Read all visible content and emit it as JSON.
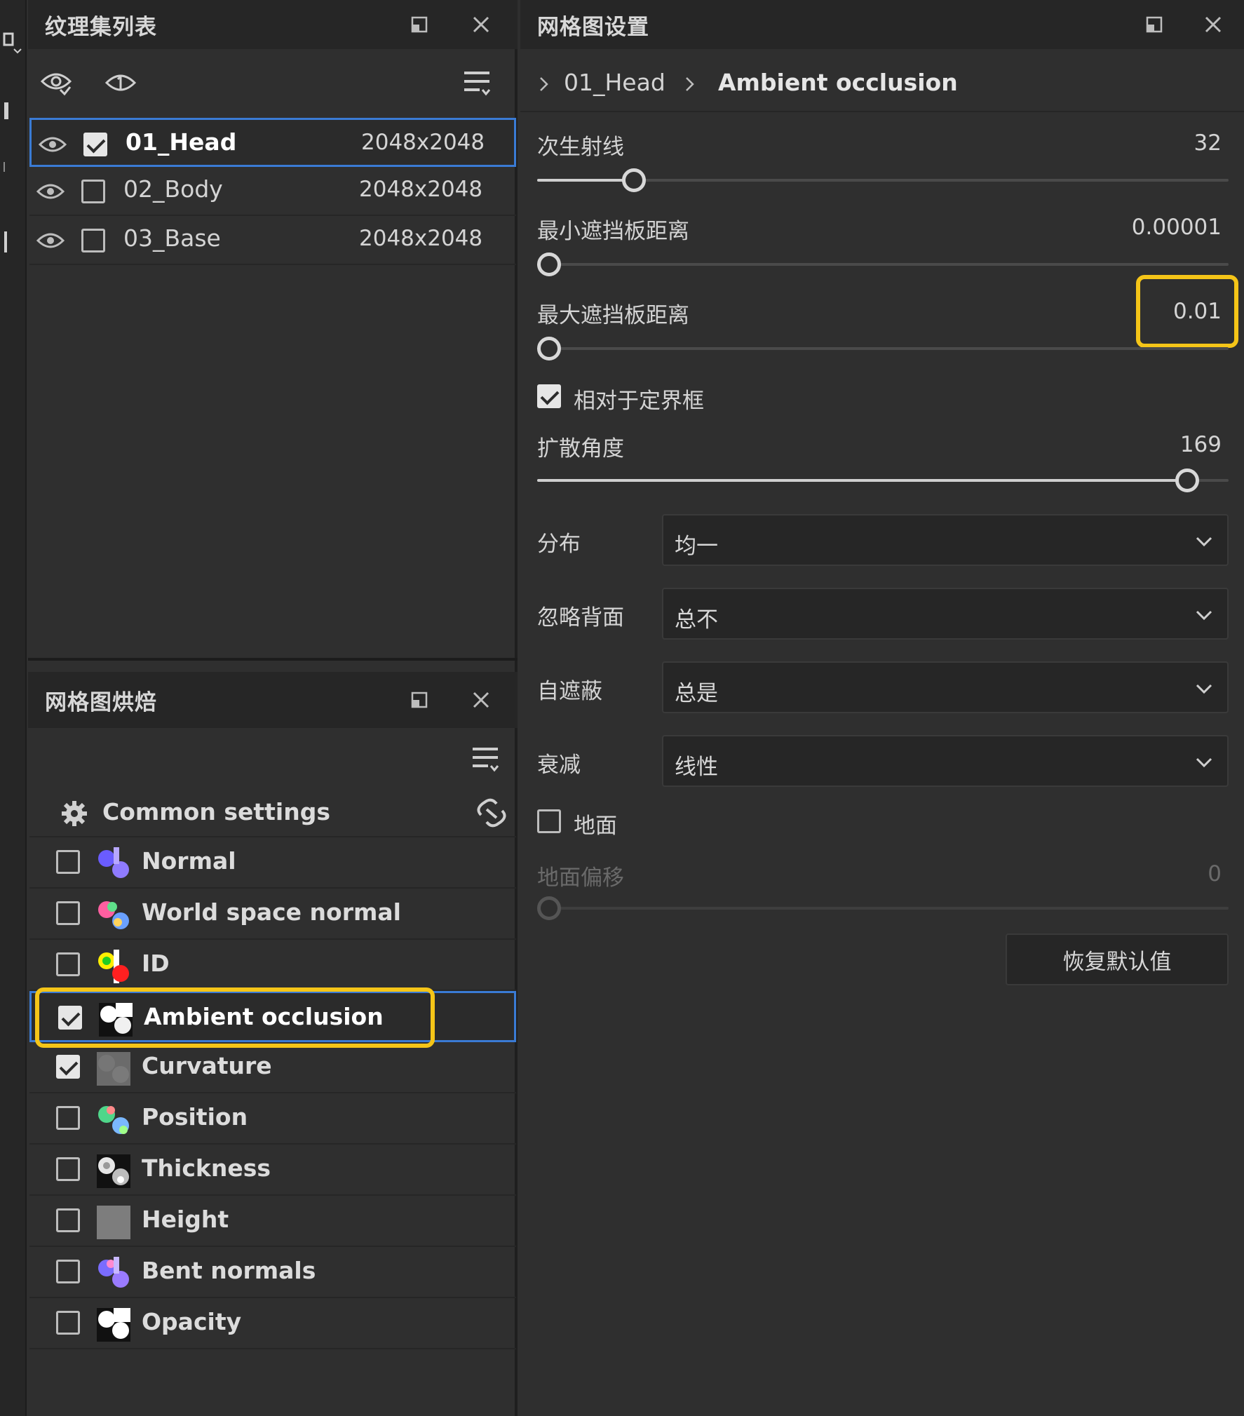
{
  "colors": {
    "accent": "#3a7bd5",
    "highlight": "#f5c518",
    "panel_bg": "#2f2f2f",
    "header_bg": "#262626"
  },
  "texture_set_panel": {
    "title": "纹理集列表",
    "rows": [
      {
        "name": "01_Head",
        "resolution": "2048x2048",
        "checked": true,
        "selected": true
      },
      {
        "name": "02_Body",
        "resolution": "2048x2048",
        "checked": false,
        "selected": false
      },
      {
        "name": "03_Base",
        "resolution": "2048x2048",
        "checked": false,
        "selected": false
      }
    ]
  },
  "bake_panel": {
    "title": "网格图烘焙",
    "common_settings": "Common settings",
    "maps": [
      {
        "label": "Normal",
        "checked": false,
        "icon": "normal-map-icon"
      },
      {
        "label": "World space normal",
        "checked": false,
        "icon": "world-space-normal-icon"
      },
      {
        "label": "ID",
        "checked": false,
        "icon": "id-map-icon"
      },
      {
        "label": "Ambient occlusion",
        "checked": true,
        "icon": "ambient-occlusion-icon",
        "selected": true
      },
      {
        "label": "Curvature",
        "checked": true,
        "icon": "curvature-icon"
      },
      {
        "label": "Position",
        "checked": false,
        "icon": "position-icon"
      },
      {
        "label": "Thickness",
        "checked": false,
        "icon": "thickness-icon"
      },
      {
        "label": "Height",
        "checked": false,
        "icon": "height-icon"
      },
      {
        "label": "Bent normals",
        "checked": false,
        "icon": "bent-normals-icon"
      },
      {
        "label": "Opacity",
        "checked": false,
        "icon": "opacity-icon"
      }
    ]
  },
  "settings_panel": {
    "title": "网格图设置",
    "breadcrumb": [
      "01_Head",
      "Ambient occlusion"
    ],
    "secondary_rays": {
      "label": "次生射线",
      "value": "32",
      "fraction": 0.14
    },
    "min_occluder": {
      "label": "最小遮挡板距离",
      "value": "0.00001",
      "fraction": 0.0
    },
    "max_occluder": {
      "label": "最大遮挡板距离",
      "value": "0.01",
      "fraction": 0.01
    },
    "relative_to_bbox": {
      "label": "相对于定界框",
      "checked": true
    },
    "spread_angle": {
      "label": "扩散角度",
      "value": "169",
      "fraction": 0.94
    },
    "distribution": {
      "label": "分布",
      "value": "均一"
    },
    "ignore_backface": {
      "label": "忽略背面",
      "value": "总不"
    },
    "self_occlusion": {
      "label": "自遮蔽",
      "value": "总是"
    },
    "attenuation": {
      "label": "衰减",
      "value": "线性"
    },
    "ground": {
      "label": "地面",
      "checked": false
    },
    "ground_offset": {
      "label": "地面偏移",
      "value": "0",
      "fraction": 0.0
    },
    "reset_button": "恢复默认值"
  }
}
